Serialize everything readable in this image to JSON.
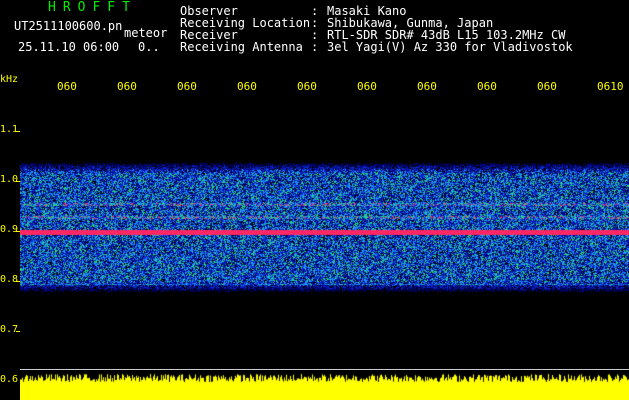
{
  "header": {
    "app_title": "HROFFT",
    "file_name": "UT2511100600.pn",
    "meteor_label": "meteor",
    "datetime": "25.11.10 06:00",
    "count": "0.."
  },
  "info": [
    {
      "label": "Observer",
      "value": "Masaki Kano"
    },
    {
      "label": "Receiving Location",
      "value": "Shibukawa, Gunma, Japan"
    },
    {
      "label": "Receiver",
      "value": "RTL-SDR SDR# 43dB L15 103.2MHz CW"
    },
    {
      "label": "Receiving Antenna",
      "value": "3el Yagi(V) Az 330 for Vladivostok"
    }
  ],
  "colon": ":",
  "axis": {
    "y_unit": "kHz",
    "y_ticks": [
      "1.1",
      "1.0",
      "0.9",
      "0.8",
      "0.7",
      "0.6"
    ],
    "x_ticks": [
      "060",
      "060",
      "060",
      "060",
      "060",
      "060",
      "060",
      "060",
      "060",
      "0610"
    ]
  },
  "colors": {
    "title": "#00ee00",
    "axis_text": "#ffff00",
    "strong_signal": "#ff3366",
    "power": "#ffff00"
  }
}
